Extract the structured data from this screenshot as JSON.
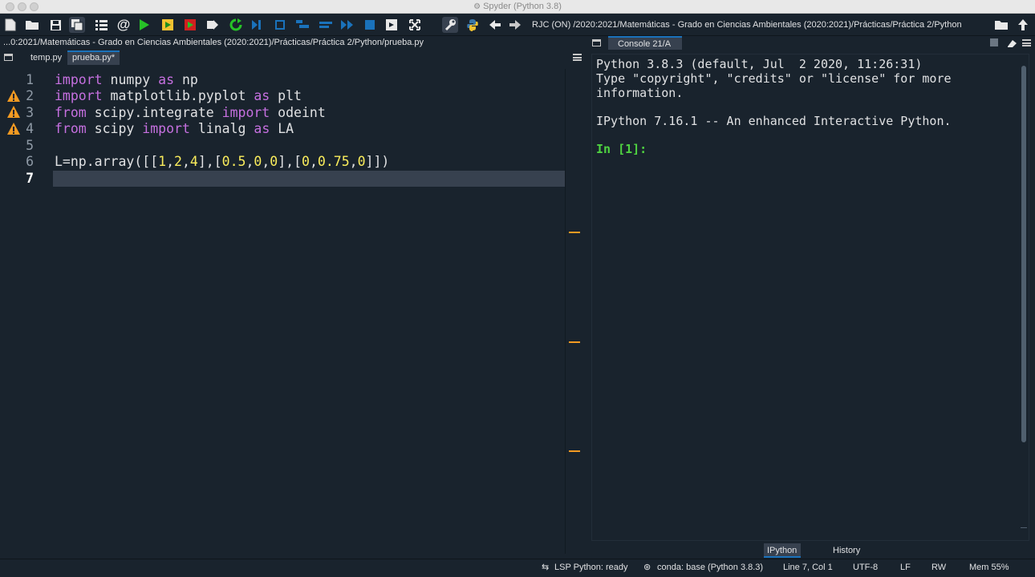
{
  "window": {
    "title": "Spyder (Python 3.8)"
  },
  "toolbar": {
    "path": "RJC (ON) /2020:2021/Matemáticas - Grado en Ciencias Ambientales (2020:2021)/Prácticas/Práctica 2/Python",
    "icons": [
      "new-file-icon",
      "open-file-icon",
      "save-icon",
      "save-all-icon",
      "outline-icon",
      "at-icon",
      "run-icon",
      "run-cell-icon",
      "run-cell-advance-icon",
      "run-selection-icon",
      "rerun-icon",
      "debug-icon",
      "step-icon",
      "step-into-icon",
      "step-return-icon",
      "continue-icon",
      "stop-icon",
      "maximize-pane-icon",
      "fullscreen-icon",
      "preferences-icon",
      "python-path-icon",
      "back-icon",
      "forward-icon",
      "browse-folder-icon",
      "parent-folder-icon"
    ]
  },
  "editor": {
    "path": "...0:2021/Matemáticas - Grado en Ciencias Ambientales (2020:2021)/Prácticas/Práctica 2/Python/prueba.py",
    "tabs": [
      {
        "label": "temp.py"
      },
      {
        "label": "prueba.py*"
      }
    ],
    "line_numbers": [
      "1",
      "2",
      "3",
      "4",
      "5",
      "6",
      "7"
    ],
    "code": {
      "l1": {
        "a": "import",
        "b": " numpy ",
        "c": "as",
        "d": " np"
      },
      "l2": {
        "a": "import",
        "b": " matplotlib.pyplot ",
        "c": "as",
        "d": " plt"
      },
      "l3": {
        "a": "from",
        "b": " scipy.integrate ",
        "c": "import",
        "d": " odeint"
      },
      "l4": {
        "a": "from",
        "b": " scipy ",
        "c": "import",
        "d": " linalg ",
        "e": "as",
        "f": " LA"
      },
      "l6": {
        "p1": "L=np.array([[",
        "n1": "1",
        "s1": ",",
        "n2": "2",
        "s2": ",",
        "n3": "4",
        "p2": "],[",
        "n4": "0.5",
        "s3": ",",
        "n5": "0",
        "s4": ",",
        "n6": "0",
        "p3": "],[",
        "n7": "0",
        "s5": ",",
        "n8": "0.75",
        "s6": ",",
        "n9": "0",
        "p4": "]])"
      }
    },
    "warning_lines": [
      2,
      3,
      4
    ],
    "current_line": 7
  },
  "console": {
    "tab": "Console 21/A",
    "lines": [
      "Python 3.8.3 (default, Jul  2 2020, 11:26:31)",
      "Type \"copyright\", \"credits\" or \"license\" for more",
      "information.",
      "IPython 7.16.1 -- An enhanced Interactive Python."
    ],
    "prompt": "In [1]:",
    "bottom_tabs": [
      "IPython console",
      "History"
    ]
  },
  "status": {
    "lsp": "LSP Python: ready",
    "conda": "conda: base (Python 3.8.3)",
    "position": "Line 7, Col 1",
    "encoding": "UTF-8",
    "eol": "LF",
    "mode": "RW",
    "mem": "Mem 55%"
  },
  "colors": {
    "background": "#19232d",
    "keyword": "#c670e0",
    "number": "#faed5c",
    "prompt": "#4fd341",
    "warning": "#f29a22",
    "accent": "#1a72bb"
  }
}
